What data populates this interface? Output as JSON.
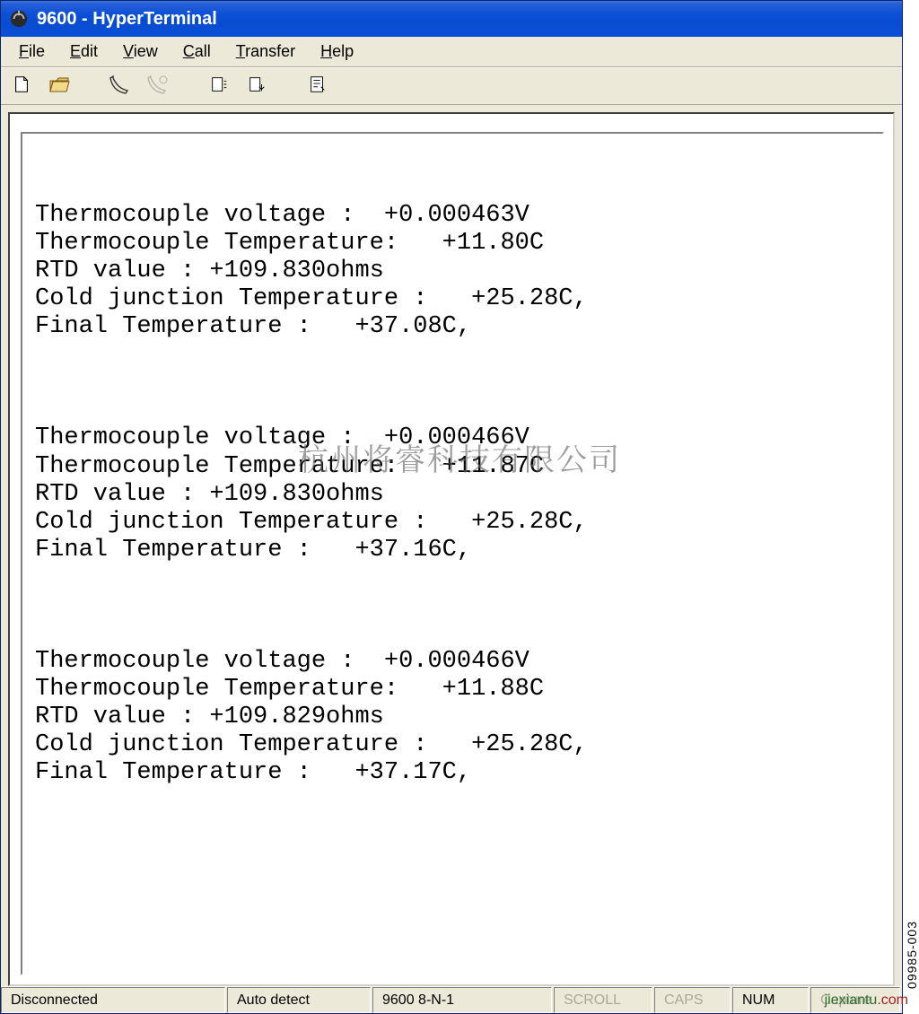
{
  "window": {
    "title": "9600 - HyperTerminal"
  },
  "menu": {
    "file": "File",
    "edit": "Edit",
    "view": "View",
    "call": "Call",
    "transfer": "Transfer",
    "help": "Help"
  },
  "toolbar": {
    "new": "new-file-icon",
    "open": "open-file-icon",
    "call": "call-icon",
    "hangup": "disconnect-icon",
    "send": "send-icon",
    "receive": "receive-icon",
    "properties": "properties-icon"
  },
  "terminal": {
    "blocks": [
      {
        "tc_voltage": "Thermocouple voltage :  +0.000463V",
        "tc_temp": "Thermocouple Temperature:   +11.80C",
        "rtd": "RTD value : +109.830ohms",
        "cj_temp": "Cold junction Temperature :   +25.28C,",
        "final": "Final Temperature :   +37.08C,"
      },
      {
        "tc_voltage": "Thermocouple voltage :  +0.000466V",
        "tc_temp": "Thermocouple Temperature:   +11.87C",
        "rtd": "RTD value : +109.830ohms",
        "cj_temp": "Cold junction Temperature :   +25.28C,",
        "final": "Final Temperature :   +37.16C,"
      },
      {
        "tc_voltage": "Thermocouple voltage :  +0.000466V",
        "tc_temp": "Thermocouple Temperature:   +11.88C",
        "rtd": "RTD value : +109.829ohms",
        "cj_temp": "Cold junction Temperature :   +25.28C,",
        "final": "Final Temperature :   +37.17C,"
      }
    ]
  },
  "status": {
    "connection": "Disconnected",
    "encoding": "Auto detect",
    "settings": "9600 8-N-1",
    "scroll": "SCROLL",
    "caps": "CAPS",
    "num": "NUM",
    "capture": "Capture"
  },
  "side_label": "09985-003",
  "watermark_center": "杭州将睿科技有限公司",
  "watermark_bottom": {
    "a": "jiexiantu",
    "b": ".com"
  }
}
